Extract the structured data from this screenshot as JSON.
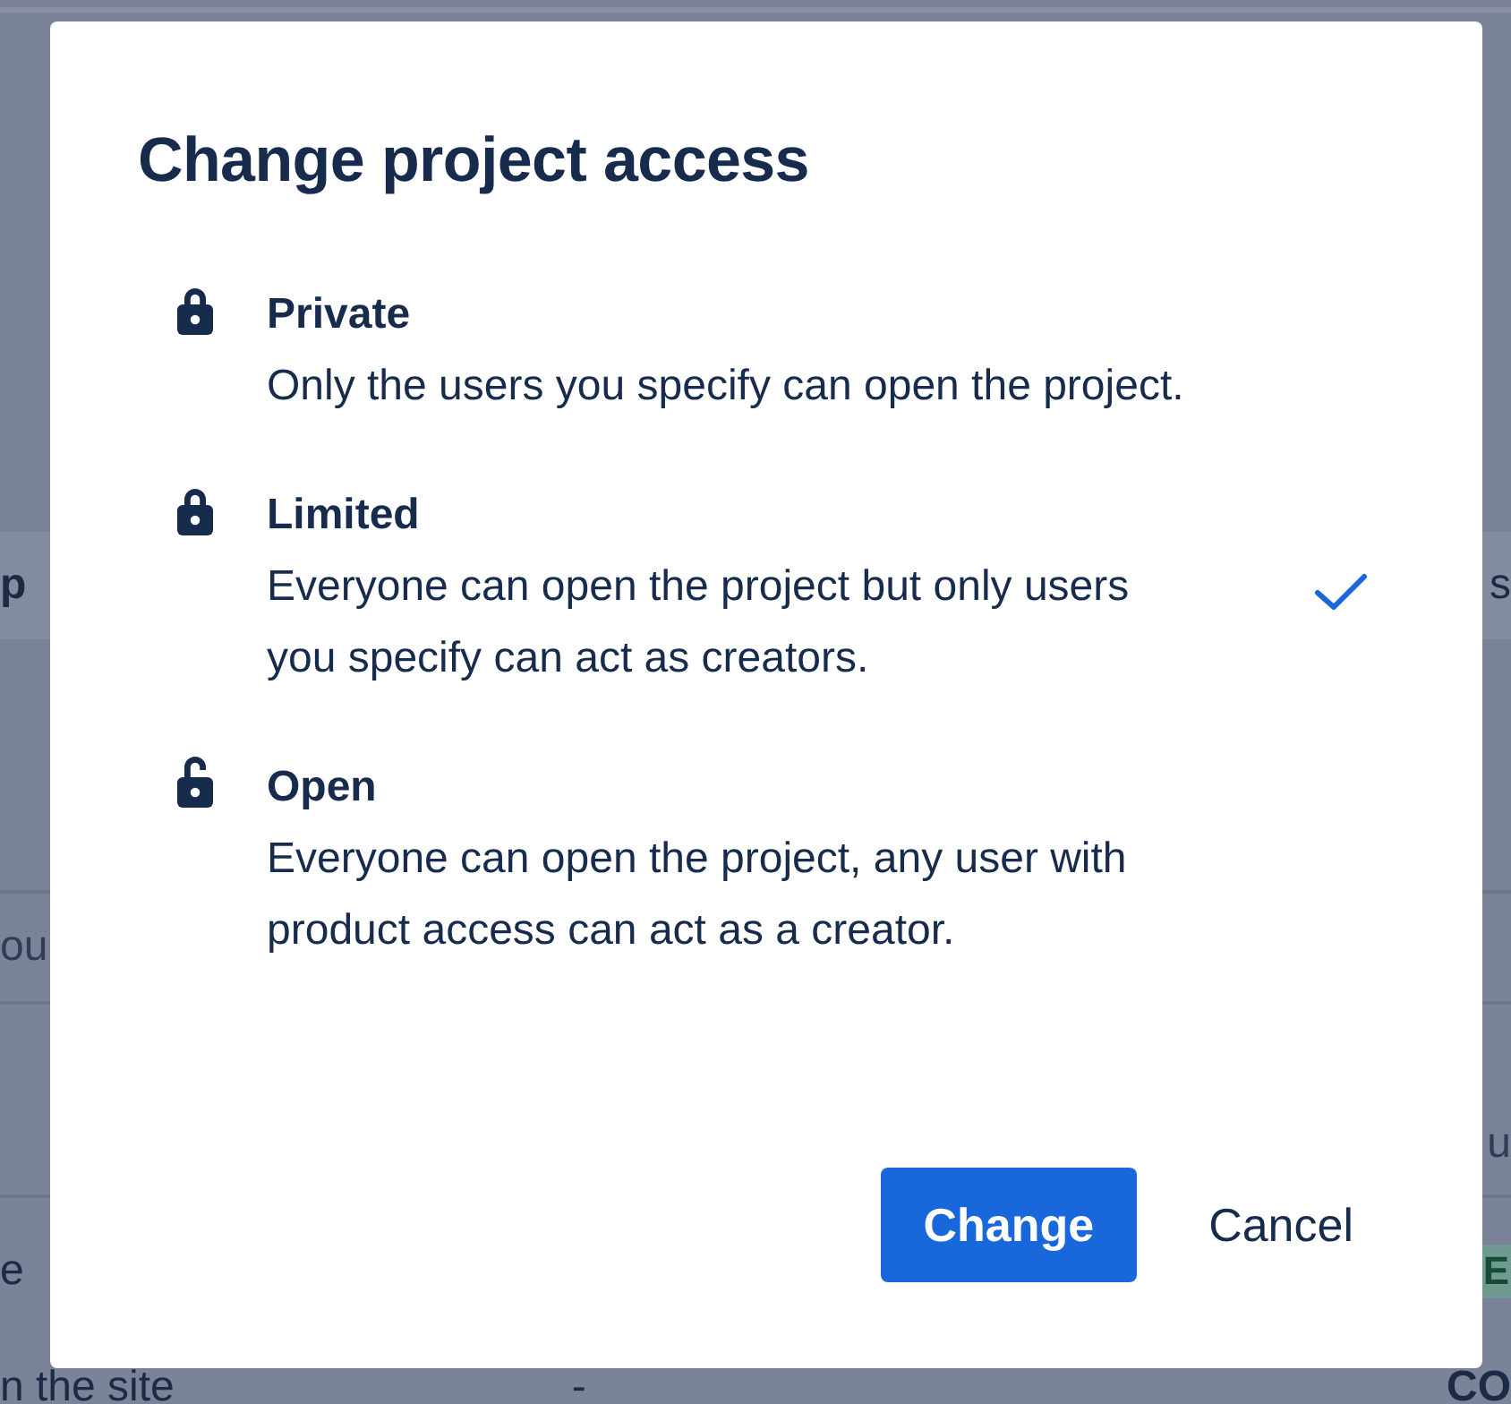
{
  "background": {
    "rows": [
      {
        "left": "p",
        "right": "s"
      },
      {
        "left": "ou",
        "right": ""
      },
      {
        "left": "",
        "right": "u"
      },
      {
        "left": "e",
        "right": "E"
      },
      {
        "left": "n the site",
        "middle": "-",
        "right": "CO"
      }
    ]
  },
  "dialog": {
    "title": "Change project access",
    "options": [
      {
        "kind": "locked",
        "title": "Private",
        "description": "Only the users you specify can open the project.",
        "selected": false
      },
      {
        "kind": "locked",
        "title": "Limited",
        "description": "Everyone can open the project but only users you specify can act as creators.",
        "selected": true
      },
      {
        "kind": "unlocked",
        "title": "Open",
        "description": "Everyone can open the project, any user with product access can act as a creator.",
        "selected": false
      }
    ],
    "buttons": [
      {
        "kind": "primary",
        "label": "Change"
      },
      {
        "kind": "subtle",
        "label": "Cancel"
      }
    ]
  }
}
